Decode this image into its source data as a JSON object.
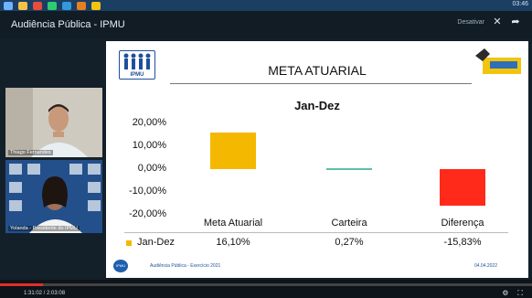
{
  "taskbar": {
    "clock": "03:46"
  },
  "meeting": {
    "title": "Audiência Pública - IPMU",
    "right_text": "Desativar",
    "close_icon": "close-icon",
    "share_icon": "share-arrow-icon"
  },
  "participants": [
    {
      "name": "Thiago Fernandes"
    },
    {
      "name": "Yolanda - Presidente do IPMU"
    }
  ],
  "slide": {
    "logo_text": "IPMU",
    "title": "META ATUARIAL",
    "chart_title": "Jan-Dez",
    "footer_text": "Audiência Pública - Exercício 2021",
    "footer_date": "04.04.2022"
  },
  "chart_data": {
    "type": "bar",
    "title": "Jan-Dez",
    "categories": [
      "Meta Atuarial",
      "Carteira",
      "Diferença"
    ],
    "series": [
      {
        "name": "Jan-Dez",
        "values": [
          16.1,
          0.27,
          -15.83
        ]
      }
    ],
    "value_labels": [
      "16,10%",
      "0,27%",
      "-15,83%"
    ],
    "bar_colors": [
      "#f5b800",
      "#5fbfa8",
      "#ff2a1a"
    ],
    "yticks": [
      "20,00%",
      "10,00%",
      "0,00%",
      "-10,00%",
      "-20,00%"
    ],
    "ylim": [
      -20,
      20
    ],
    "legend": "table-row"
  },
  "bottom": {
    "time_text": "1:31:02 / 2:03:08",
    "progress": 0.08
  }
}
